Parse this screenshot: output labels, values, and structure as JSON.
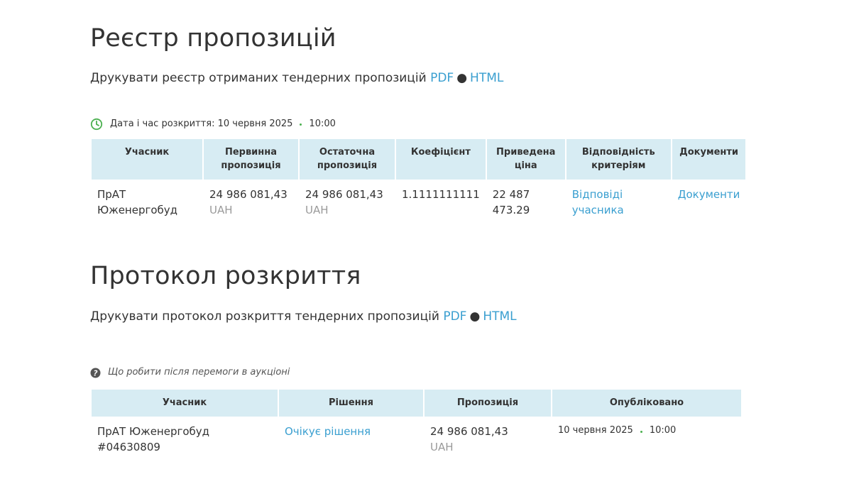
{
  "registry": {
    "title": "Реєстр пропозицій",
    "print_text": "Друкувати реєстр отриманих тендерних пропозицій",
    "pdf_label": "PDF",
    "separator": "●",
    "html_label": "HTML",
    "opening_label": "Дата і час розкриття: 10 червня 2025",
    "opening_time": "10:00",
    "table": {
      "headers": {
        "participant": "Учасник",
        "initial_offer": "Первинна пропозиція",
        "final_offer": "Остаточна пропозиція",
        "coefficient": "Коефіцієнт",
        "adjusted_price": "Приведена ціна",
        "criteria_match": "Відповідність критеріям",
        "documents": "Документи"
      },
      "rows": [
        {
          "participant": "ПрАТ Юженергобуд",
          "initial_amount": "24 986 081,43",
          "initial_currency": "UAH",
          "final_amount": "24 986 081,43",
          "final_currency": "UAH",
          "coefficient": "1.1111111111",
          "adjusted_price": "22 487 473.29",
          "criteria_link": "Відповіді учасника",
          "documents_link": "Документи"
        }
      ]
    }
  },
  "protocol": {
    "title": "Протокол розкриття",
    "print_text": "Друкувати протокол розкриття тендерних пропозицій",
    "pdf_label": "PDF",
    "separator": "●",
    "html_label": "HTML",
    "help_text": "Що робити після перемоги в аукціоні",
    "table": {
      "headers": {
        "participant": "Учасник",
        "decision": "Рішення",
        "offer": "Пропозиція",
        "published": "Опубліковано"
      },
      "rows": [
        {
          "participant": "ПрАТ Юженергобуд #04630809",
          "decision_link": "Очікує рішення",
          "offer_amount": "24 986 081,43",
          "offer_currency": "UAH",
          "published_date": "10 червня 2025",
          "published_time": "10:00"
        }
      ]
    }
  },
  "colors": {
    "link": "#3a9fd0",
    "header_bg": "#d7ecf3",
    "clock_icon": "#4cb050",
    "currency_text": "#9a9a9a"
  },
  "icons": {
    "clock": "clock-icon",
    "help": "question-circle-icon"
  }
}
